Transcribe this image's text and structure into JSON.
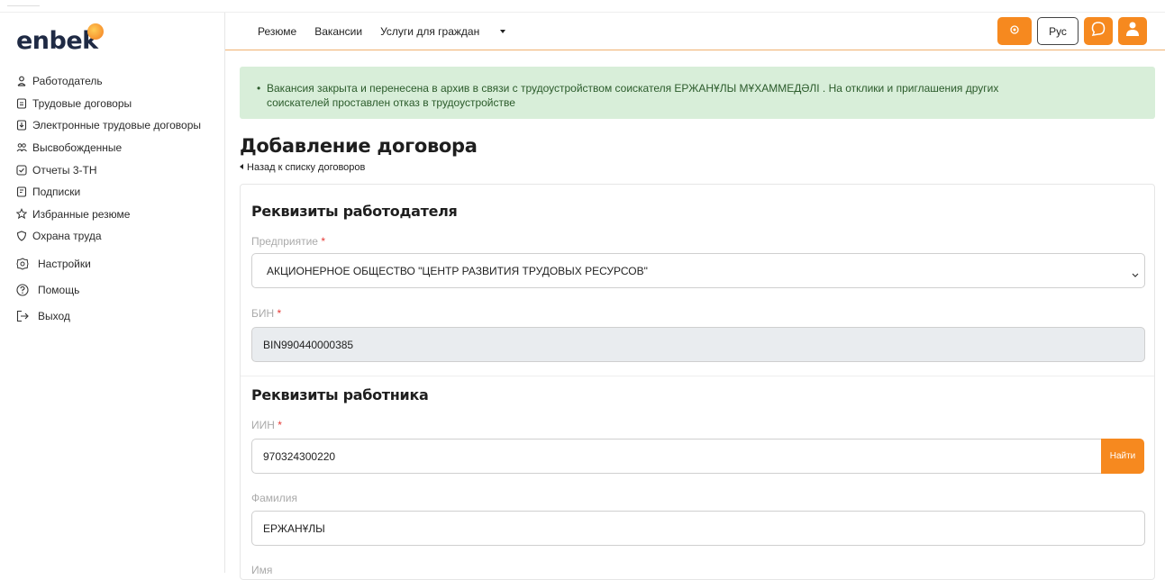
{
  "brand": {
    "logo_text": "enbek"
  },
  "sidebar": {
    "items": [
      {
        "label": "Работодатель",
        "icon": "user-icon"
      },
      {
        "label": "Трудовые договоры",
        "icon": "document-icon"
      },
      {
        "label": "Электронные трудовые договоры",
        "icon": "e-document-icon"
      },
      {
        "label": "Высвобожденные",
        "icon": "users-icon"
      },
      {
        "label": "Отчеты 3-ТН",
        "icon": "check-square-icon"
      },
      {
        "label": "Подписки",
        "icon": "bookmark-icon"
      },
      {
        "label": "Избранные резюме",
        "icon": "star-icon"
      },
      {
        "label": "Охрана труда",
        "icon": "shield-icon"
      },
      {
        "label": "Настройки",
        "icon": "gear-icon"
      },
      {
        "label": "Помощь",
        "icon": "help-icon"
      },
      {
        "label": "Выход",
        "icon": "logout-icon"
      }
    ]
  },
  "header": {
    "nav": [
      "Резюме",
      "Вакансии",
      "Услуги для граждан"
    ],
    "lang": "Рус",
    "accent": "#f6891f"
  },
  "alert": {
    "line1": "Вакансия закрыта и перенесена в архив в связи с трудоустройством соискателя ЕРЖАНҰЛЫ МҰХАММЕДӘЛІ . На отклики и приглашения других",
    "line2": "соискателей проставлен отказ в трудоустройстве"
  },
  "page": {
    "title": "Добавление договора",
    "back_link": "Назад к списку договоров"
  },
  "employer": {
    "title": "Реквизиты работодателя",
    "enterprise_label": "Предприятие",
    "enterprise_value": "АКЦИОНЕРНОЕ ОБЩЕСТВО \"ЦЕНТР РАЗВИТИЯ ТРУДОВЫХ РЕСУРСОВ\"",
    "bin_label": "БИН",
    "bin_value": "BIN990440000385"
  },
  "employee": {
    "title": "Реквизиты работника",
    "iin_label": "ИИН",
    "iin_value": "970324300220",
    "find_label": "Найти",
    "surname_label": "Фамилия",
    "surname_value": "ЕРЖАНҰЛЫ",
    "name_label": "Имя"
  },
  "required_mark": "*"
}
